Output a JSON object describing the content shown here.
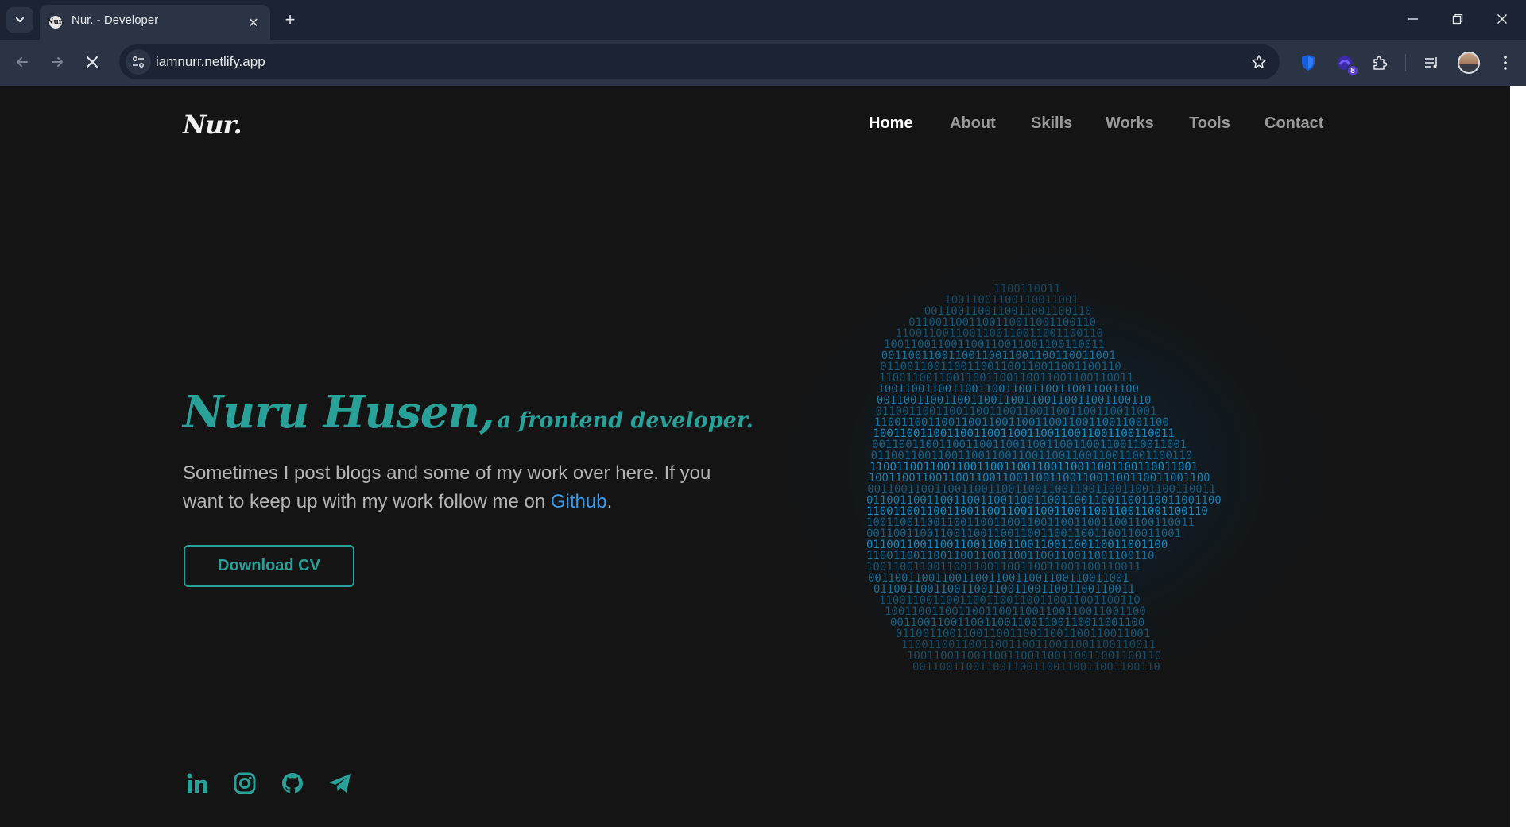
{
  "browser": {
    "tab_title": "Nur. - Developer",
    "url": "iamnurr.netlify.app",
    "extension_badge": "8"
  },
  "site": {
    "logo": "Nur.",
    "nav": [
      {
        "label": "Home",
        "active": true
      },
      {
        "label": "About",
        "active": false
      },
      {
        "label": "Skills",
        "active": false
      },
      {
        "label": "Works",
        "active": false
      },
      {
        "label": "Tools",
        "active": false
      },
      {
        "label": "Contact",
        "active": false
      }
    ],
    "hero": {
      "name": "Nuru Husen,",
      "role": "a frontend developer.",
      "text_before": "Sometimes I post blogs and some of my work over here. If you want to keep up with my work follow me on ",
      "link_text": "Github",
      "text_after": ".",
      "cta": "Download CV"
    },
    "social_icons": [
      "linkedin-icon",
      "instagram-icon",
      "github-icon",
      "telegram-icon"
    ],
    "binary_pattern": "1001100110011001"
  },
  "colors": {
    "accent": "#2aa198",
    "link": "#3a9be8",
    "background": "#141414",
    "art": "#1e9fe0"
  }
}
